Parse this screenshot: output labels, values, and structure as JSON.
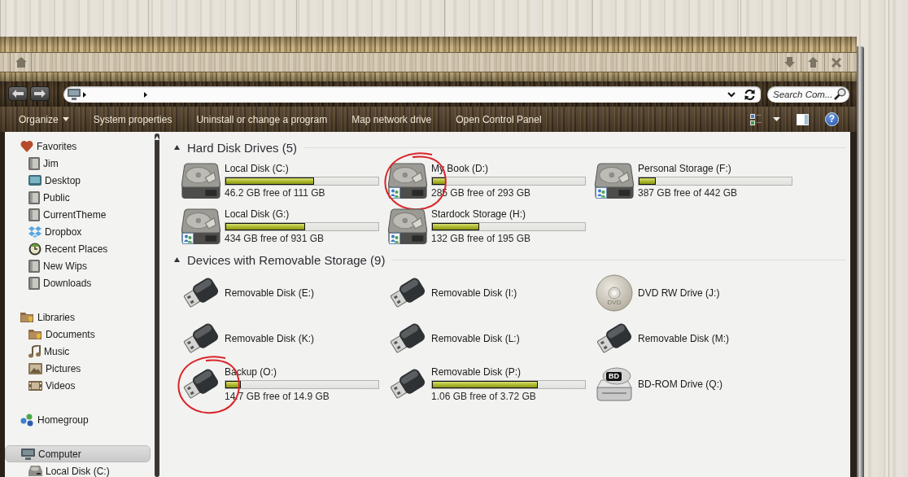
{
  "search": {
    "placeholder": "Search Com..."
  },
  "command_bar": {
    "items": [
      {
        "label": "Organize",
        "kind": "menu"
      },
      {
        "label": "System properties",
        "kind": "command"
      },
      {
        "label": "Uninstall or change a program",
        "kind": "command"
      },
      {
        "label": "Map network drive",
        "kind": "command"
      },
      {
        "label": "Open Control Panel",
        "kind": "command"
      }
    ],
    "help": "?"
  },
  "sidebar": {
    "groups": [
      {
        "label": "Favorites",
        "kind": "favorites",
        "selected": false,
        "children": [
          {
            "label": "Jim",
            "kind": "folder",
            "selected": false
          },
          {
            "label": "Desktop",
            "kind": "desktop",
            "selected": false
          },
          {
            "label": "Public",
            "kind": "folder",
            "selected": false
          },
          {
            "label": "CurrentTheme",
            "kind": "folder",
            "selected": false
          },
          {
            "label": "Dropbox",
            "kind": "dropbox",
            "selected": false
          },
          {
            "label": "Recent Places",
            "kind": "recent",
            "selected": false
          },
          {
            "label": "New Wips",
            "kind": "folder",
            "selected": false
          },
          {
            "label": "Downloads",
            "kind": "folder",
            "selected": false
          }
        ]
      },
      {
        "label": "Libraries",
        "kind": "library",
        "selected": false,
        "children": [
          {
            "label": "Documents",
            "kind": "library",
            "selected": false
          },
          {
            "label": "Music",
            "kind": "music",
            "selected": false
          },
          {
            "label": "Pictures",
            "kind": "pictures",
            "selected": false
          },
          {
            "label": "Videos",
            "kind": "videos",
            "selected": false
          }
        ]
      },
      {
        "label": "Homegroup",
        "kind": "homegroup",
        "selected": false
      },
      {
        "label": "Computer",
        "kind": "computer",
        "selected": true,
        "children": [
          {
            "label": "Local Disk (C:)",
            "kind": "drive",
            "selected": false
          }
        ]
      }
    ]
  },
  "sections": [
    {
      "title": "Hard Disk Drives (5)",
      "expanded": true,
      "drives": [
        {
          "name": "Local Disk (C:)",
          "kind": "hdd",
          "shared": false,
          "circled": false,
          "level": 0.58,
          "free": "46.2 GB free of 111 GB"
        },
        {
          "name": "My Book (D:)",
          "kind": "hdd",
          "shared": true,
          "circled": true,
          "level": 0.09,
          "free": "285 GB free of 293 GB"
        },
        {
          "name": "Personal Storage (F:)",
          "kind": "hdd",
          "shared": true,
          "circled": false,
          "level": 0.11,
          "free": "387 GB free of 442 GB"
        },
        {
          "name": "Local Disk (G:)",
          "kind": "hdd",
          "shared": true,
          "circled": false,
          "level": 0.52,
          "free": "434 GB free of 931 GB"
        },
        {
          "name": "Stardock Storage (H:)",
          "kind": "hdd",
          "shared": true,
          "circled": false,
          "level": 0.31,
          "free": "132 GB free of 195 GB"
        }
      ]
    },
    {
      "title": "Devices with Removable Storage (9)",
      "expanded": true,
      "drives": [
        {
          "name": "Removable Disk (E:)",
          "kind": "usb",
          "shared": false,
          "circled": false
        },
        {
          "name": "Removable Disk (I:)",
          "kind": "usb",
          "shared": false,
          "circled": false
        },
        {
          "name": "DVD RW Drive (J:)",
          "kind": "dvd",
          "icon_label": "DVD",
          "shared": false,
          "circled": false
        },
        {
          "name": "Removable Disk (K:)",
          "kind": "usb",
          "shared": false,
          "circled": false
        },
        {
          "name": "Removable Disk (L:)",
          "kind": "usb",
          "shared": false,
          "circled": false
        },
        {
          "name": "Removable Disk (M:)",
          "kind": "usb",
          "shared": false,
          "circled": false
        },
        {
          "name": "Backup (O:)",
          "kind": "usb",
          "shared": false,
          "circled": true,
          "level": 0.1,
          "free": "14.7 GB free of 14.9 GB"
        },
        {
          "name": "Removable Disk (P:)",
          "kind": "usb",
          "shared": false,
          "circled": false,
          "level": 0.69,
          "free": "1.06 GB free of 3.72 GB"
        },
        {
          "name": "BD-ROM Drive (Q:)",
          "kind": "bd",
          "icon_label": "BD",
          "shared": false,
          "circled": false
        }
      ]
    }
  ]
}
